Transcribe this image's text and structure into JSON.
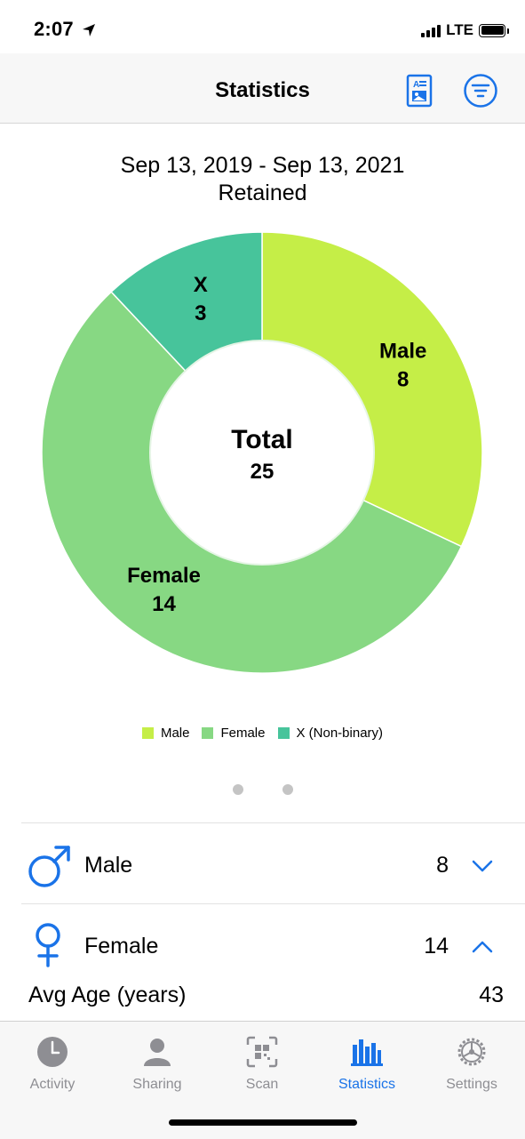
{
  "status": {
    "time": "2:07",
    "network": "LTE"
  },
  "nav": {
    "title": "Statistics",
    "report_icon": "report-icon",
    "filter_icon": "filter-icon"
  },
  "header": {
    "date_range": "Sep 13, 2019 - Sep 13, 2021",
    "subtitle": "Retained"
  },
  "chart_data": {
    "type": "pie",
    "donut": true,
    "categories": [
      "Male",
      "Female",
      "X"
    ],
    "values": [
      8,
      14,
      3
    ],
    "legend_labels": [
      "Male",
      "Female",
      "X (Non-binary)"
    ],
    "colors": [
      "#c5ee47",
      "#87d883",
      "#47c49b"
    ],
    "center_title": "Total",
    "center_value": "25",
    "legend_position": "bottom"
  },
  "rows": {
    "male": {
      "label": "Male",
      "value": "8",
      "icon": "male-symbol-icon",
      "expanded": false
    },
    "female": {
      "label": "Female",
      "value": "14",
      "icon": "female-symbol-icon",
      "expanded": true
    },
    "avg_age": {
      "label": "Avg Age (years)",
      "value": "43"
    }
  },
  "tabs": [
    {
      "label": "Activity",
      "icon": "clock-icon",
      "active": false
    },
    {
      "label": "Sharing",
      "icon": "person-icon",
      "active": false
    },
    {
      "label": "Scan",
      "icon": "qr-code-icon",
      "active": false
    },
    {
      "label": "Statistics",
      "icon": "bar-chart-icon",
      "active": true
    },
    {
      "label": "Settings",
      "icon": "gear-icon",
      "active": false
    }
  ],
  "colors": {
    "accent": "#1a73e8",
    "inactive": "#8e8e93"
  }
}
